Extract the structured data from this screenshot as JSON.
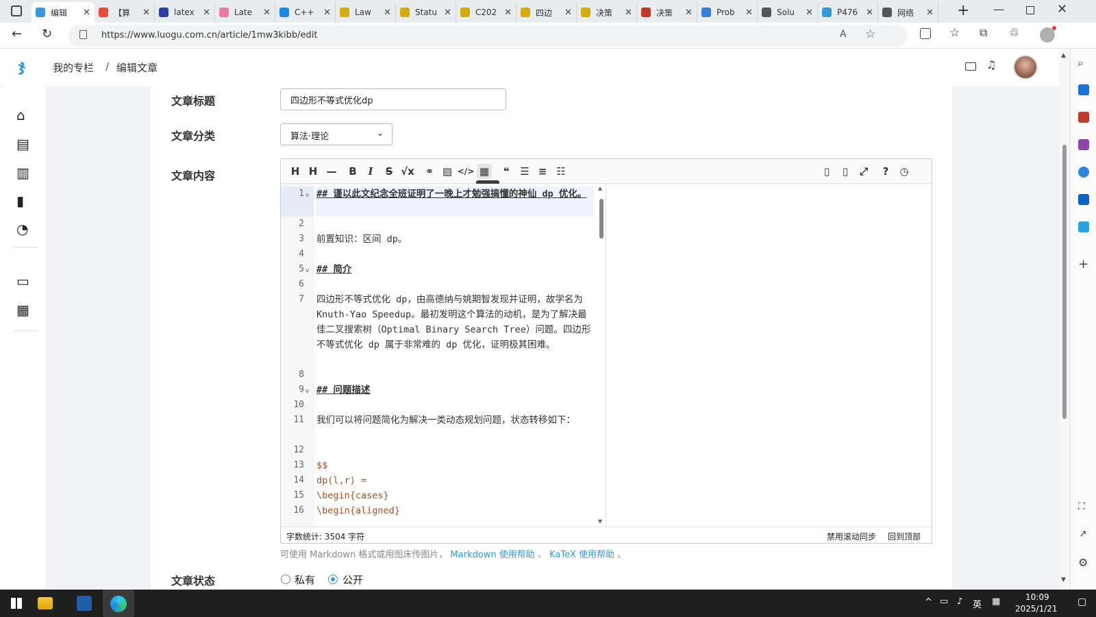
{
  "browser": {
    "tabs": [
      {
        "label": "编辑",
        "color": "#3498db",
        "active": true
      },
      {
        "label": "【算",
        "color": "#e74c3c"
      },
      {
        "label": "latex",
        "color": "#2b3ea8"
      },
      {
        "label": "Late",
        "color": "#e87aa6"
      },
      {
        "label": "C++",
        "color": "#1e88e5"
      },
      {
        "label": "Law",
        "color": "#d4ac0d"
      },
      {
        "label": "Statu",
        "color": "#d4ac0d"
      },
      {
        "label": "C202",
        "color": "#d4ac0d"
      },
      {
        "label": "四边",
        "color": "#d4ac0d"
      },
      {
        "label": "决策",
        "color": "#d4ac0d"
      },
      {
        "label": "决策",
        "color": "#c0392b"
      },
      {
        "label": "Prob",
        "color": "#3b7dd8"
      },
      {
        "label": "Solu",
        "color": "#555555"
      },
      {
        "label": "P476",
        "color": "#3498db"
      },
      {
        "label": "网络",
        "color": "#555555"
      }
    ],
    "url": "https://www.luogu.com.cn/article/1mw3kibb/edit"
  },
  "header": {
    "breadcrumb": [
      "我的专栏",
      "/",
      "编辑文章"
    ]
  },
  "sidebar_icons": [
    "home-icon",
    "book-icon",
    "clipboard-icon",
    "ranking-icon",
    "pie-chart-icon",
    "chat-icon",
    "news-icon"
  ],
  "form": {
    "title_label": "文章标题",
    "title_value": "四边形不等式优化dp",
    "category_label": "文章分类",
    "category_value": "算法·理论",
    "content_label": "文章内容",
    "status_label": "文章状态",
    "status_private": "私有",
    "status_public": "公开",
    "help_prefix": "可使用 Markdown 格式或用图床传图片，",
    "help_md": "Markdown 使用帮助",
    "help_sep": "、",
    "help_katex": "KaTeX 使用帮助",
    "help_end": "。"
  },
  "editor": {
    "tooltip": "表格",
    "lines": [
      {
        "n": "1",
        "fold": true,
        "text": "## 谨以此文纪念全班证明了一晚上才勉强搞懂的神仙 dp 优化。",
        "style": "h"
      },
      {
        "n": "2",
        "text": ""
      },
      {
        "n": "3",
        "text": "前置知识：区间 dp。"
      },
      {
        "n": "4",
        "text": ""
      },
      {
        "n": "5",
        "fold": true,
        "text": "## 简介",
        "style": "h"
      },
      {
        "n": "6",
        "text": ""
      },
      {
        "n": "7",
        "text": "四边形不等式优化 dp，由高德纳与姚期智发现并证明，故学名为 Knuth-Yao Speedup。最初发明这个算法的动机，是为了解决最佳二叉搜索树（Optimal Binary Search Tree）问题。四边形不等式优化 dp 属于非常难的 dp 优化，证明极其困难。"
      },
      {
        "n": "8",
        "text": ""
      },
      {
        "n": "9",
        "fold": true,
        "text": "## 问题描述",
        "style": "h"
      },
      {
        "n": "10",
        "text": ""
      },
      {
        "n": "11",
        "text": "我们可以将问题简化为解决一类动态规划问题，状态转移如下："
      },
      {
        "n": "12",
        "text": ""
      },
      {
        "n": "13",
        "text": "$$",
        "style": "m"
      },
      {
        "n": "14",
        "text": "dp(l,r) =",
        "style": "m"
      },
      {
        "n": "15",
        "text": "\\begin{cases}",
        "style": "m"
      },
      {
        "n": "16",
        "text": "\\begin{aligned}",
        "style": "m"
      }
    ],
    "word_count": "字数统计: 3504 字符",
    "disable_sync": "禁用滚动同步",
    "back_top": "回到顶部"
  },
  "taskbar": {
    "time": "10:09",
    "date": "2025/1/21",
    "ime": "英"
  },
  "colors": {
    "brand": "#3498db",
    "link": "#3498db",
    "heading": "#333333"
  }
}
